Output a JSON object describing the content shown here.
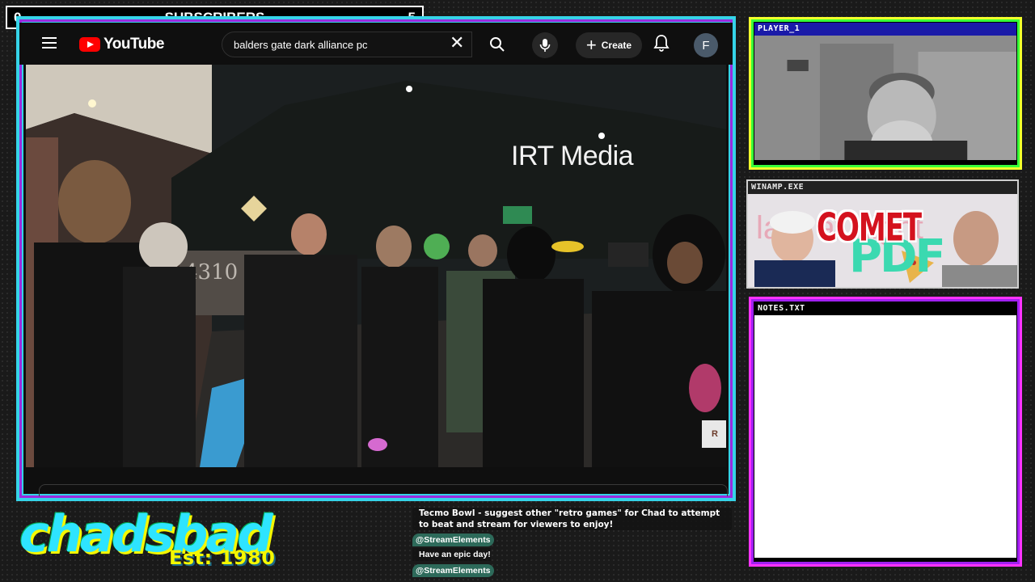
{
  "subscribers": {
    "left_value": "0",
    "label": "SUBSCRIBERS",
    "right_value": "5"
  },
  "youtube": {
    "logo_text": "YouTube",
    "search_value": "balders gate dark alliance pc",
    "create_label": "Create",
    "avatar_letter": "F",
    "video": {
      "watermark": "IRT Media",
      "sign_number": "4310",
      "corner_logo_text": "R"
    }
  },
  "panels": {
    "player": {
      "title": "PLAYER_1"
    },
    "winamp": {
      "title": "WINAMP.EXE",
      "art_text": "COMET",
      "art_text_2": "PDF",
      "art_bg_text": "late at night"
    },
    "notes": {
      "title": "NOTES.TXT"
    }
  },
  "brand": {
    "name": "chadsbad",
    "est": "Est: 1980"
  },
  "chat": {
    "messages": [
      {
        "user": "",
        "text": "Tecmo Bowl - suggest other \"retro games\" for Chad to attempt to beat and stream for viewers to enjoy!"
      },
      {
        "user": "@StreamElements",
        "text": "Have an epic day!"
      },
      {
        "user": "@StreamElements",
        "text": ""
      }
    ]
  },
  "colors": {
    "cyan": "#35d3e8",
    "purple": "#9b2ce0",
    "yellow": "#f2ff2b",
    "green": "#38ff3a",
    "magenta": "#ff33ff",
    "yt_red": "#ff0000"
  }
}
